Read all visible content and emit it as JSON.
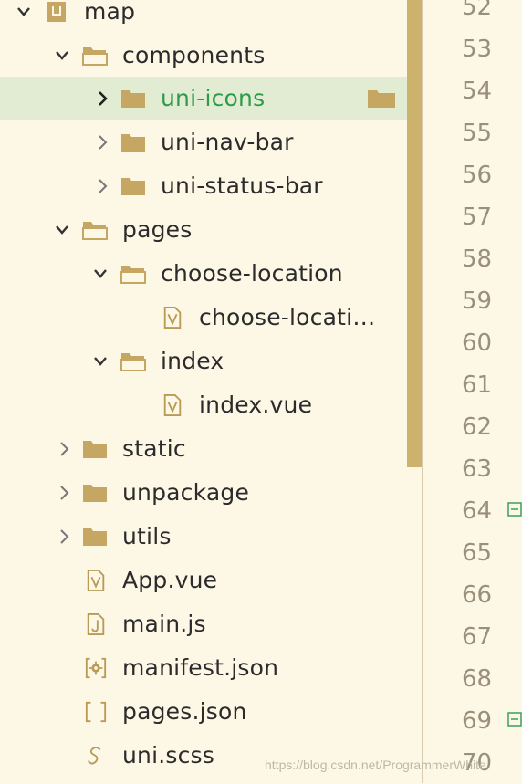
{
  "tree": {
    "root": {
      "label": "map"
    },
    "components": {
      "label": "components"
    },
    "uni_icons": {
      "label": "uni-icons"
    },
    "uni_nav_bar": {
      "label": "uni-nav-bar"
    },
    "uni_status_bar": {
      "label": "uni-status-bar"
    },
    "pages": {
      "label": "pages"
    },
    "choose_location_folder": {
      "label": "choose-location"
    },
    "choose_location_file": {
      "label": "choose-locati…"
    },
    "index_folder": {
      "label": "index"
    },
    "index_vue": {
      "label": "index.vue"
    },
    "static": {
      "label": "static"
    },
    "unpackage": {
      "label": "unpackage"
    },
    "utils": {
      "label": "utils"
    },
    "app_vue": {
      "label": "App.vue"
    },
    "main_js": {
      "label": "main.js"
    },
    "manifest_json": {
      "label": "manifest.json"
    },
    "pages_json": {
      "label": "pages.json"
    },
    "uni_scss": {
      "label": "uni.scss"
    }
  },
  "line_numbers": [
    "52",
    "53",
    "54",
    "55",
    "56",
    "57",
    "58",
    "59",
    "60",
    "61",
    "62",
    "63",
    "64",
    "65",
    "66",
    "67",
    "68",
    "69",
    "70"
  ],
  "watermark": "https://blog.csdn.net/ProgrammerWhite",
  "colors": {
    "background": "#fdf7e6",
    "selected_row": "#e2ecd3",
    "selected_text": "#2e9b4b",
    "folder_icon": "#c5a662",
    "scrollbar": "#cdb26d",
    "fold_marker": "#3aa05a"
  }
}
